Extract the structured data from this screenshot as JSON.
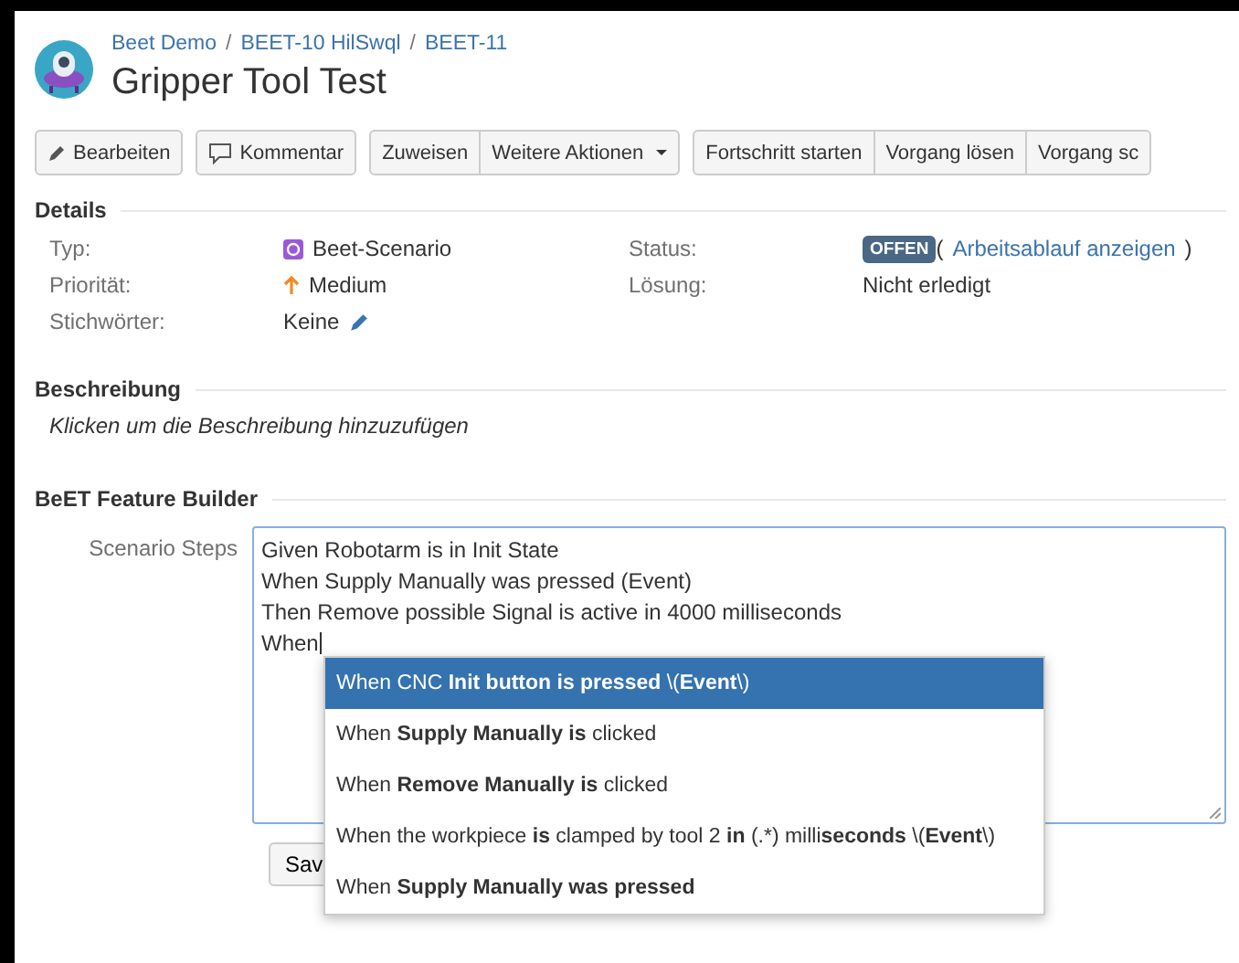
{
  "breadcrumbs": [
    {
      "label": "Beet Demo"
    },
    {
      "separator": "/",
      "label": "BEET-10 HilSwql"
    },
    {
      "separator": "/",
      "label": "BEET-11"
    }
  ],
  "title": "Gripper Tool Test",
  "toolbar": [
    [
      {
        "label": "Bearbeiten",
        "kind": "edit"
      }
    ],
    [
      {
        "label": "Kommentar",
        "kind": "comment"
      }
    ],
    [
      {
        "label": "Zuweisen"
      },
      {
        "label": "Weitere Aktionen",
        "dropdown": true
      }
    ],
    [
      {
        "label": "Fortschritt starten"
      },
      {
        "label": "Vorgang lösen"
      },
      {
        "label": "Vorgang sc"
      }
    ]
  ],
  "details": {
    "heading": "Details",
    "left": [
      {
        "label": "Typ:",
        "value": "Beet-Scenario",
        "kind": "type"
      },
      {
        "label": "Priorität:",
        "value": "Medium",
        "kind": "priority"
      },
      {
        "label": "Stichwörter:",
        "value": "Keine",
        "kind": "labels"
      }
    ],
    "right": [
      {
        "label": "Status:",
        "badge": "OFFEN",
        "open_paren": "(",
        "link": "Arbeitsablauf anzeigen",
        "close_paren": ")",
        "kind": "status"
      },
      {
        "label": "Lösung:",
        "value": "Nicht erledigt",
        "kind": "text"
      }
    ]
  },
  "description": {
    "heading": "Beschreibung",
    "placeholder": "Klicken um die Beschreibung hinzuzufügen"
  },
  "feature_builder": {
    "heading": "BeET Feature Builder",
    "field_label": "Scenario Steps",
    "lines": [
      "Given Robotarm is in Init State",
      "When Supply Manually was pressed (Event)",
      "Then Remove possible Signal is active in 4000 milliseconds",
      "When"
    ],
    "save_button": "Sav",
    "suggestions": [
      {
        "text": "When CNC **Init button is pressed** \\(**Event**\\)",
        "selected": true
      },
      {
        "text": "When **Supply Manually is** clicked",
        "selected": false
      },
      {
        "text": "When **Remove Manually is** clicked",
        "selected": false
      },
      {
        "text": "When the workpiece **is** clamped by tool 2 **in** (.*) milli**seconds** \\(**Event**\\)",
        "selected": false
      },
      {
        "text": "When **Supply Manually was pressed**",
        "selected": false
      }
    ]
  }
}
